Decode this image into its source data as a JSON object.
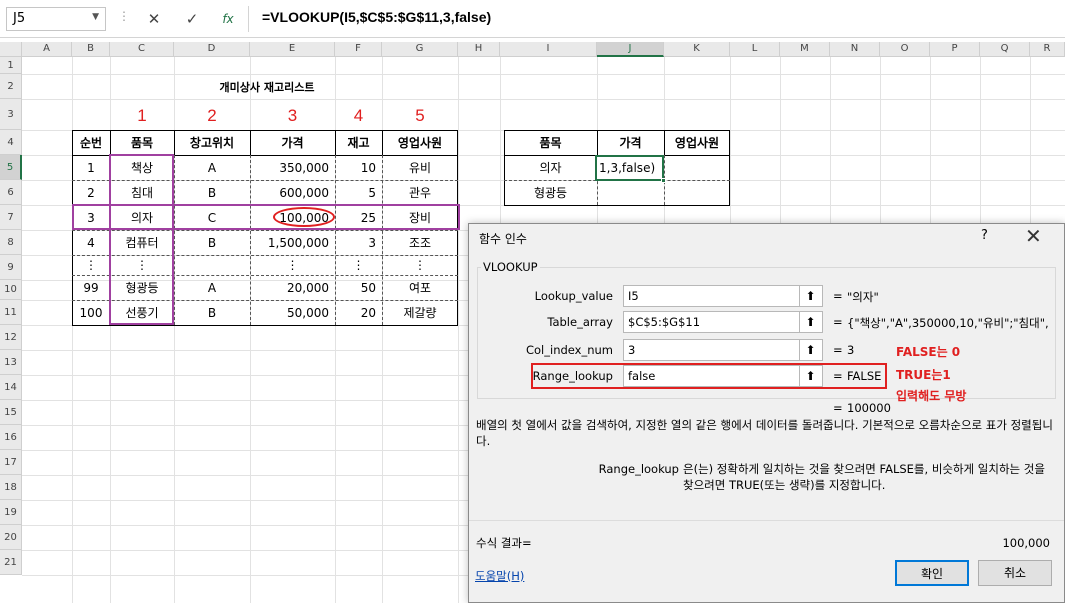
{
  "formula_bar": {
    "name_box": "J5",
    "cancel_icon": "✕",
    "enter_icon": "✓",
    "fx_icon": "fx",
    "formula": "=VLOOKUP(I5,$C$5:$G$11,3,false)"
  },
  "columns": [
    "A",
    "B",
    "C",
    "D",
    "E",
    "F",
    "G",
    "H",
    "I",
    "J",
    "K",
    "L",
    "M",
    "N",
    "O",
    "P",
    "Q",
    "R"
  ],
  "rows": [
    "1",
    "2",
    "3",
    "4",
    "5",
    "6",
    "7",
    "8",
    "9",
    "10",
    "11",
    "12",
    "13",
    "14",
    "15",
    "16",
    "17",
    "18",
    "19",
    "20",
    "21"
  ],
  "sheet": {
    "title": "개미상사 재고리스트",
    "col_numbers": [
      "1",
      "2",
      "3",
      "4",
      "5"
    ],
    "table_headers": [
      "순번",
      "품목",
      "창고위치",
      "가격",
      "재고",
      "영업사원"
    ],
    "table_rows": [
      [
        "1",
        "책상",
        "A",
        "350,000",
        "10",
        "유비"
      ],
      [
        "2",
        "침대",
        "B",
        "600,000",
        "5",
        "관우"
      ],
      [
        "3",
        "의자",
        "C",
        "100,000",
        "25",
        "장비"
      ],
      [
        "4",
        "컴퓨터",
        "B",
        "1,500,000",
        "3",
        "조조"
      ],
      [
        "⋮",
        "⋮",
        "",
        "⋮",
        "⋮",
        "⋮"
      ],
      [
        "99",
        "형광등",
        "A",
        "20,000",
        "50",
        "여포"
      ],
      [
        "100",
        "선풍기",
        "B",
        "50,000",
        "20",
        "제갈량"
      ]
    ],
    "lookup_headers": [
      "품목",
      "가격",
      "영업사원"
    ],
    "lookup_rows": [
      [
        "의자",
        "1,3,false)",
        ""
      ],
      [
        "형광등",
        "",
        ""
      ]
    ]
  },
  "dialog": {
    "title": "함수 인수",
    "help_icon": "?",
    "close_icon": "✕",
    "function_name": "VLOOKUP",
    "args": [
      {
        "label": "Lookup_value",
        "value": "I5",
        "result": "\"의자\""
      },
      {
        "label": "Table_array",
        "value": "$C$5:$G$11",
        "result": "{\"책상\",\"A\",350000,10,\"유비\";\"침대\","
      },
      {
        "label": "Col_index_num",
        "value": "3",
        "result": "3"
      },
      {
        "label": "Range_lookup",
        "value": "false",
        "result": "FALSE"
      }
    ],
    "collapse_icon": "⬆",
    "equals": "=",
    "overall_result": "100000",
    "description": "배열의 첫 열에서 값을 검색하여, 지정한 열의 같은 행에서 데이터를 돌려줍니다. 기본적으로 오름차순으로 표가 정렬됩니다.",
    "arg_help_name": "Range_lookup",
    "arg_help_text": "은(는) 정확하게 일치하는 것을 찾으려면 FALSE를, 비슷하게 일치하는 것을 찾으려면 TRUE(또는 생략)를 지정합니다.",
    "formula_result_label": "수식 결과=",
    "formula_result_value": "100,000",
    "help_link": "도움말(H)",
    "ok_label": "확인",
    "cancel_label": "취소"
  },
  "annotations": {
    "false_note": "FALSE는 0",
    "true_note": "TRUE는1",
    "input_note": "입력해도 무방"
  },
  "colors": {
    "accent": "#217346",
    "annotation_red": "#e02020",
    "purple_box": "#a040a0"
  }
}
